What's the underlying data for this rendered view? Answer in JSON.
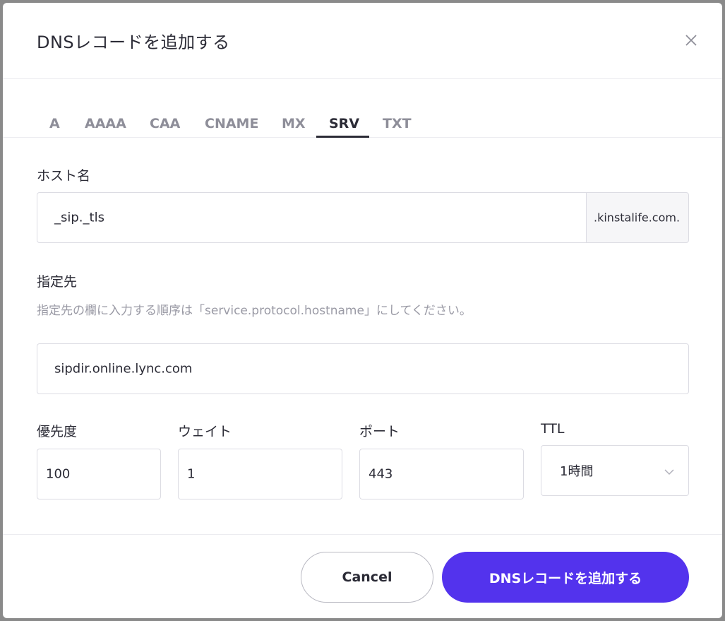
{
  "dialog": {
    "title": "DNSレコードを追加する"
  },
  "tabs": [
    {
      "label": "A",
      "active": false
    },
    {
      "label": "AAAA",
      "active": false
    },
    {
      "label": "CAA",
      "active": false
    },
    {
      "label": "CNAME",
      "active": false
    },
    {
      "label": "MX",
      "active": false
    },
    {
      "label": "SRV",
      "active": true
    },
    {
      "label": "TXT",
      "active": false
    }
  ],
  "form": {
    "hostname": {
      "label": "ホスト名",
      "value": "_sip._tls",
      "suffix": ".kinstalife.com."
    },
    "target": {
      "label": "指定先",
      "help": "指定先の欄に入力する順序は「service.protocol.hostname」にしてください。",
      "value": "sipdir.online.lync.com"
    },
    "priority": {
      "label": "優先度",
      "value": "100"
    },
    "weight": {
      "label": "ウェイト",
      "value": "1"
    },
    "port": {
      "label": "ポート",
      "value": "443"
    },
    "ttl": {
      "label": "TTL",
      "value": "1時間"
    }
  },
  "footer": {
    "cancel_label": "Cancel",
    "submit_label": "DNSレコードを追加する"
  },
  "colors": {
    "primary": "#5333ed",
    "text": "#2b2b36",
    "muted": "#8e8e99"
  },
  "icons": [
    "close-icon",
    "chevron-down-icon"
  ]
}
